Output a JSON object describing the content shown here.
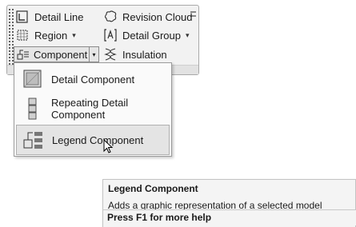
{
  "ribbon": {
    "tools": {
      "detail_line": "Detail Line",
      "revision_cloud": "Revision Cloud",
      "region": "Region",
      "detail_group": "Detail Group",
      "component": "Component",
      "insulation": "Insulation"
    },
    "dropdown_caret": "▾"
  },
  "component_menu": {
    "items": [
      {
        "label": "Detail Component",
        "icon": "detail-component-icon"
      },
      {
        "label": "Repeating Detail Component",
        "icon": "repeating-detail-component-icon"
      },
      {
        "label": "Legend Component",
        "icon": "legend-component-icon",
        "hovered": true
      }
    ]
  },
  "tooltip": {
    "title": "Legend Component",
    "description": "Adds a graphic representation of a selected model element to a legend view.",
    "help": "Press F1 for more help"
  }
}
